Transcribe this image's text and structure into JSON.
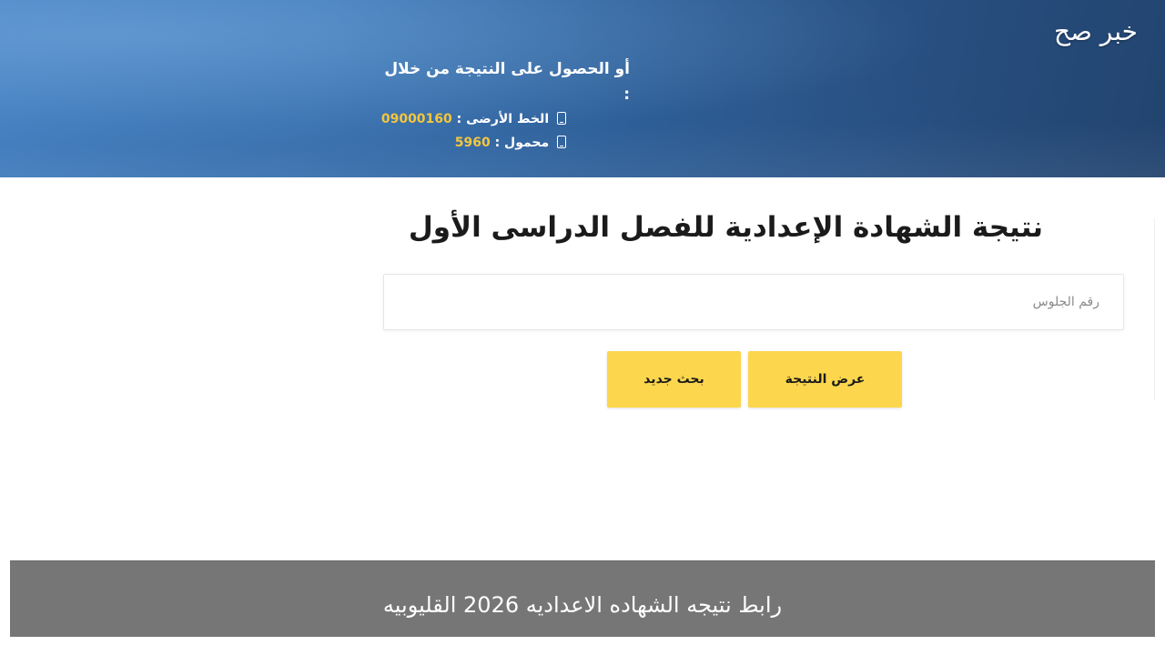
{
  "header": {
    "brand": "خبر صح",
    "contact_title": "أو الحصول على النتيجة من خلال :",
    "landline_label": "الخط الأرضى :",
    "landline_number": "09000160",
    "mobile_label": "محمول :",
    "mobile_number": "5960",
    "accent_color": "#f5c63b"
  },
  "form": {
    "title": "نتيجة الشهادة الإعدادية للفصل الدراسى الأول",
    "seat_number_placeholder": "رقم الجلوس",
    "seat_number_value": "",
    "show_result_label": "عرض النتيجة",
    "new_search_label": "بحث جديد",
    "button_color": "#fcd64d"
  },
  "caption": {
    "text": "رابط نتيجه الشهاده الاعداديه 2026 القليوبيه"
  }
}
